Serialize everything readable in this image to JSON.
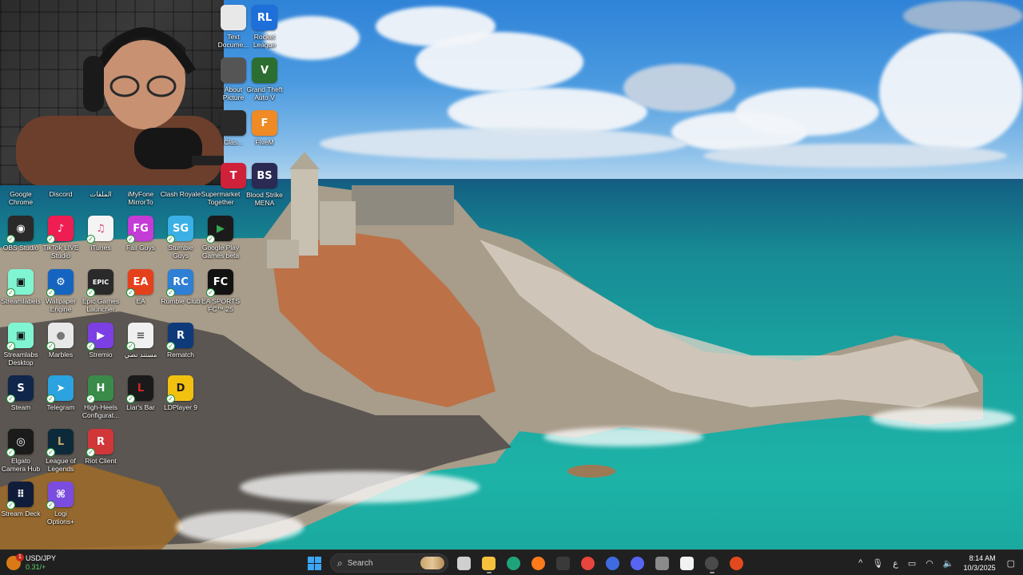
{
  "desktop": {
    "icons": [
      {
        "id": "text-file",
        "label": "Text\nDocume...",
        "color": "#e8e8e8",
        "glyph": "",
        "fg": "#333"
      },
      {
        "id": "rocket-league",
        "label": "Rocket\nLeague",
        "color": "#1e6fd9",
        "glyph": "RL",
        "fg": "#fff"
      },
      {
        "id": "about-picture",
        "label": "About\nPicture",
        "color": "#555",
        "glyph": "",
        "fg": "#fff"
      },
      {
        "id": "gta5",
        "label": "Grand Theft\nAuto V",
        "color": "#2c6e2f",
        "glyph": "V",
        "fg": "#fff"
      },
      {
        "id": "hidden-3",
        "label": "Clas...",
        "color": "#2a2a2a",
        "glyph": "",
        "fg": "#fff"
      },
      {
        "id": "fivem",
        "label": "FiveM",
        "color": "#f08a24",
        "glyph": "F",
        "fg": "#fff"
      },
      {
        "id": "hidden-4",
        "label": "",
        "color": "#d0213b",
        "glyph": "T",
        "fg": "#fff"
      },
      {
        "id": "blood-strike",
        "label": "Blood Strike\nMENA",
        "color": "#2a2a55",
        "glyph": "BS",
        "fg": "#fff"
      },
      {
        "id": "google-chrome",
        "label": "Google\nChrome",
        "color": "#1a73e8",
        "glyph": "",
        "fg": "#fff"
      },
      {
        "id": "discord",
        "label": "Discord",
        "color": "#5865f2",
        "glyph": "",
        "fg": "#fff"
      },
      {
        "id": "arabic-folder",
        "label": "الملفات",
        "color": "#caa24b",
        "glyph": "",
        "fg": "#fff"
      },
      {
        "id": "imyfone",
        "label": "iMyFone\nMirrorTo",
        "color": "#3a8af0",
        "glyph": "",
        "fg": "#fff"
      },
      {
        "id": "clash-royale",
        "label": "Clash Royale",
        "color": "#2d6cc0",
        "glyph": "",
        "fg": "#fff"
      },
      {
        "id": "supermarket",
        "label": "Supermarket\nTogether",
        "color": "#d64a2e",
        "glyph": "",
        "fg": "#fff"
      },
      {
        "id": "obs-studio",
        "label": "OBS Studio",
        "color": "#2a2a2a",
        "glyph": "◉",
        "fg": "#fff"
      },
      {
        "id": "tiktok-live",
        "label": "TikTok LIVE\nStudio",
        "color": "#ee1d52",
        "glyph": "♪",
        "fg": "#fff"
      },
      {
        "id": "itunes",
        "label": "iTunes",
        "color": "#f4f4f4",
        "glyph": "♫",
        "fg": "#e0447b"
      },
      {
        "id": "fall-guys",
        "label": "Fall Guys",
        "color": "#c43bd6",
        "glyph": "FG",
        "fg": "#fff"
      },
      {
        "id": "stumble-guys",
        "label": "Stumble\nGuys",
        "color": "#3bb0e6",
        "glyph": "SG",
        "fg": "#fff"
      },
      {
        "id": "google-play-games",
        "label": "Google Play\nGames beta",
        "color": "#1b1b1b",
        "glyph": "▶",
        "fg": "#34a853"
      },
      {
        "id": "streamlabels",
        "label": "Streamlabels",
        "color": "#80f5d2",
        "glyph": "▣",
        "fg": "#111"
      },
      {
        "id": "wallpaper-engine",
        "label": "Wallpaper\nEngine",
        "color": "#1565c0",
        "glyph": "⚙",
        "fg": "#fff"
      },
      {
        "id": "epic-games",
        "label": "Epic Games\nLauncher",
        "color": "#2a2a2a",
        "glyph": "EPIC",
        "fg": "#fff"
      },
      {
        "id": "ea",
        "label": "EA",
        "color": "#e5401c",
        "glyph": "EA",
        "fg": "#fff"
      },
      {
        "id": "rumble-club",
        "label": "Rumble Club",
        "color": "#2f7fd4",
        "glyph": "RC",
        "fg": "#fff"
      },
      {
        "id": "ea-sports-fc",
        "label": "EA SPORTS\nFC™ 25",
        "color": "#121212",
        "glyph": "FC",
        "fg": "#fff"
      },
      {
        "id": "streamlabs-desktop",
        "label": "Streamlabs\nDesktop",
        "color": "#80f5d2",
        "glyph": "▣",
        "fg": "#111"
      },
      {
        "id": "marbles",
        "label": "Marbles",
        "color": "#e8e8e8",
        "glyph": "●",
        "fg": "#777"
      },
      {
        "id": "stremio",
        "label": "Stremio",
        "color": "#7b3fe4",
        "glyph": "▶",
        "fg": "#fff"
      },
      {
        "id": "arabic-doc",
        "label": "مستند نصي",
        "color": "#f0f0f0",
        "glyph": "≡",
        "fg": "#555"
      },
      {
        "id": "rematch",
        "label": "Rematch",
        "color": "#0f3a7a",
        "glyph": "R",
        "fg": "#fff"
      },
      {
        "id": "steam",
        "label": "Steam",
        "color": "#10264a",
        "glyph": "S",
        "fg": "#fff"
      },
      {
        "id": "telegram",
        "label": "Telegram",
        "color": "#2aa3e0",
        "glyph": "➤",
        "fg": "#fff"
      },
      {
        "id": "high-heels",
        "label": "High-Heels\nConfigurat...",
        "color": "#3a8a4a",
        "glyph": "H",
        "fg": "#fff"
      },
      {
        "id": "liars-bar",
        "label": "Liar's Bar",
        "color": "#1a1a1a",
        "glyph": "L",
        "fg": "#d22"
      },
      {
        "id": "ldplayer",
        "label": "LDPlayer 9",
        "color": "#f2c10f",
        "glyph": "D",
        "fg": "#1a1a1a"
      },
      {
        "id": "elgato-camera",
        "label": "Elgato\nCamera Hub",
        "color": "#1b1b1b",
        "glyph": "◎",
        "fg": "#fff"
      },
      {
        "id": "league-of-legends",
        "label": "League of\nLegends",
        "color": "#0d2a3a",
        "glyph": "L",
        "fg": "#c8aa6e"
      },
      {
        "id": "riot-client",
        "label": "Riot Client",
        "color": "#d13639",
        "glyph": "R",
        "fg": "#fff"
      },
      {
        "id": "stream-deck",
        "label": "Stream Deck",
        "color": "#101d3a",
        "glyph": "⠿",
        "fg": "#fff"
      },
      {
        "id": "logi-options",
        "label": "Logi\nOptions+",
        "color": "#7a4de0",
        "glyph": "⌘",
        "fg": "#fff"
      }
    ]
  },
  "taskbar": {
    "widget": {
      "title": "USD/JPY",
      "value": "0.31/+",
      "badge": "1",
      "color": "#d97a16"
    },
    "search": {
      "placeholder": "Search"
    },
    "apps": [
      {
        "id": "start",
        "color": "#3ba7f5",
        "running": false
      },
      {
        "id": "task-view",
        "color": "#cfcfcf",
        "running": false
      },
      {
        "id": "file-explorer",
        "color": "#f4c23d",
        "running": true
      },
      {
        "id": "edge",
        "color": "#1fa37a",
        "running": false
      },
      {
        "id": "firefox",
        "color": "#ff7a1a",
        "running": false
      },
      {
        "id": "app-dark",
        "color": "#3a3a3a",
        "running": false
      },
      {
        "id": "chrome",
        "color": "#e8453c",
        "running": false
      },
      {
        "id": "isp",
        "color": "#3f6be0",
        "running": false
      },
      {
        "id": "discord",
        "color": "#5865f2",
        "running": false
      },
      {
        "id": "close-box",
        "color": "#8a8a8a",
        "running": false
      },
      {
        "id": "streamlabs",
        "color": "#f2f2f2",
        "running": false
      },
      {
        "id": "obs",
        "color": "#4a4a4a",
        "running": true
      },
      {
        "id": "extra",
        "color": "#e24a1e",
        "running": false
      }
    ],
    "tray": {
      "chevron": "^",
      "lang": "ع",
      "time": "8:14 AM",
      "date": "10/3/2025"
    }
  }
}
